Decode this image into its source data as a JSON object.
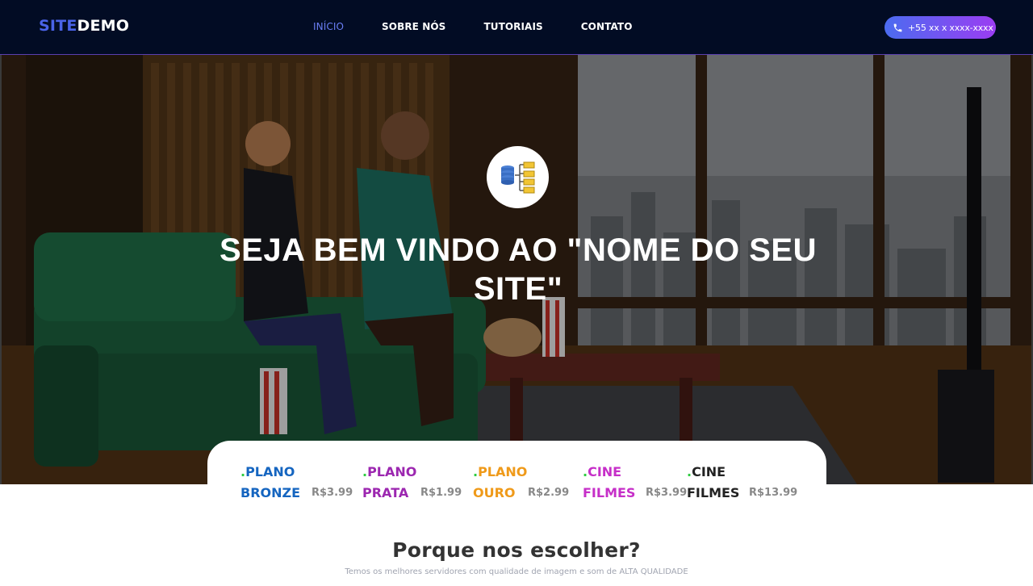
{
  "brand": {
    "part1": "SITE",
    "part2": "DEMO"
  },
  "nav": {
    "links": [
      "INÍCIO",
      "SOBRE NÓS",
      "TUTORIAIS",
      "CONTATO"
    ]
  },
  "phone": {
    "label": "+55 xx x xxxx-xxxx",
    "icon": "phone-icon"
  },
  "hero": {
    "logo_icon": "database-tree-icon",
    "title": "SEJA BEM VINDO AO \"NOME DO SEU SITE\""
  },
  "plans": [
    {
      "prefix": ".",
      "line1": "PLANO",
      "line2": "BRONZE",
      "price": "R$3.99",
      "color": "#1565c0"
    },
    {
      "prefix": ".",
      "line1": "PLANO",
      "line2": "PRATA",
      "price": "R$1.99",
      "color": "#9c27b0"
    },
    {
      "prefix": ".",
      "line1": "PLANO",
      "line2": "OURO",
      "price": "R$2.99",
      "color": "#ef9a1a"
    },
    {
      "prefix": ".",
      "line1": "CINE",
      "line2": "FILMES",
      "price": "R$3.99",
      "color": "#c62fc8"
    },
    {
      "prefix": ".",
      "line1": "CINE",
      "line2": "FILMES",
      "price": "R$13.99",
      "color": "#222222"
    }
  ],
  "why": {
    "title": "Porque nos escolher?",
    "subtitle": "Temos os melhores servidores com qualidade de imagem e som de ALTA QUALIDADE"
  },
  "colors": {
    "nav_bg": "#020c24",
    "accent_blue": "#4a63e8",
    "accent_purple": "#9b3df2",
    "dot_green": "#2ecc40"
  }
}
